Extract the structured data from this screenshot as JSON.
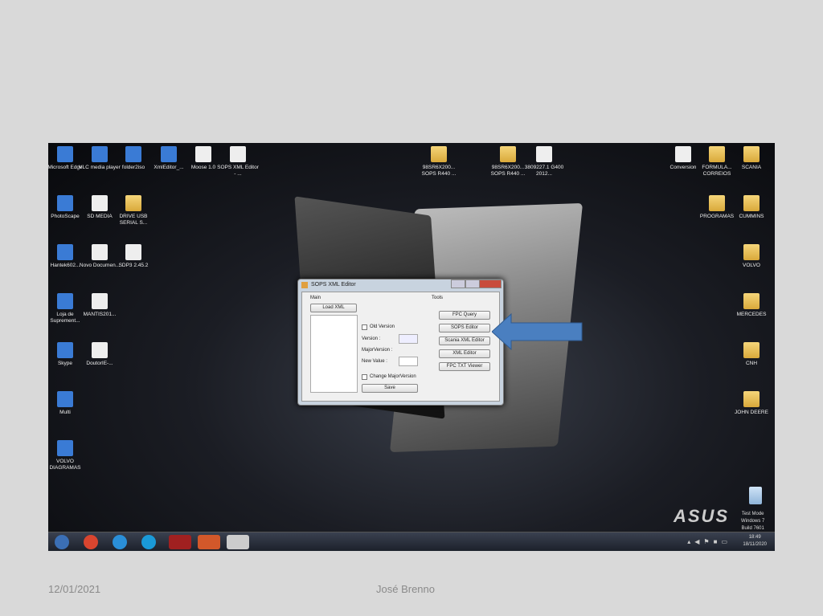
{
  "slide": {
    "date": "12/01/2021",
    "author": "José Brenno"
  },
  "desktop": {
    "icons_left": [
      "Microsoft Edge",
      "VLC media player",
      "folder2iso",
      "XmlEditor_...",
      "Moose 1.0",
      "SOPS XML Editor - ...",
      "PhotoScape",
      "SD MEDIA",
      "DRIVE USB SERIAL S...",
      "Hantek602...",
      "Novo Documen...",
      "SDP3 2.45.2",
      "Loja de Suprement...",
      "MANTIS201...",
      "Skype",
      "DoutorIE-...",
      "Multi",
      "VOLVO DIAGRAMAS"
    ],
    "icons_mid": [
      "98SR6X200... SOPS R440 ...",
      "98SR6X200... SOPS R440 ...",
      "3809227.1 G400 2012..."
    ],
    "icons_right": [
      "Conversion",
      "FORMULA... CORREIOS",
      "SCANIA",
      "PROGRAMAS",
      "CUMMINS",
      "VOLVO",
      "MERCEDES",
      "CNH",
      "JOHN DEERE"
    ],
    "brand": "ASUS",
    "watermark": [
      "Test Mode",
      "Windows 7",
      "Build 7601"
    ]
  },
  "dialog": {
    "title": "SOPS XML Editor",
    "main_label": "Main",
    "tools_label": "Tools",
    "load_xml": "Load XML",
    "old_version": "Old Version",
    "version": "Version :",
    "major_version": "MajorVersion :",
    "new_value": "New Value :",
    "change_major": "Change MajorVersion",
    "save": "Save",
    "tools": [
      "FPC Query",
      "SOPS Editor",
      "Scania XML Editor",
      "XML Editor",
      "FPC TXT Viewer"
    ]
  },
  "taskbar": {
    "apps": [
      "start",
      "chrome",
      "internet-explorer",
      "edge",
      "mcafee",
      "powerpoint",
      "sops-xml-editor"
    ],
    "time": "18:49",
    "date": "18/11/2020"
  },
  "colors": {
    "arrow": "#4a7fc0",
    "slide_bg": "#d9d9d9"
  }
}
